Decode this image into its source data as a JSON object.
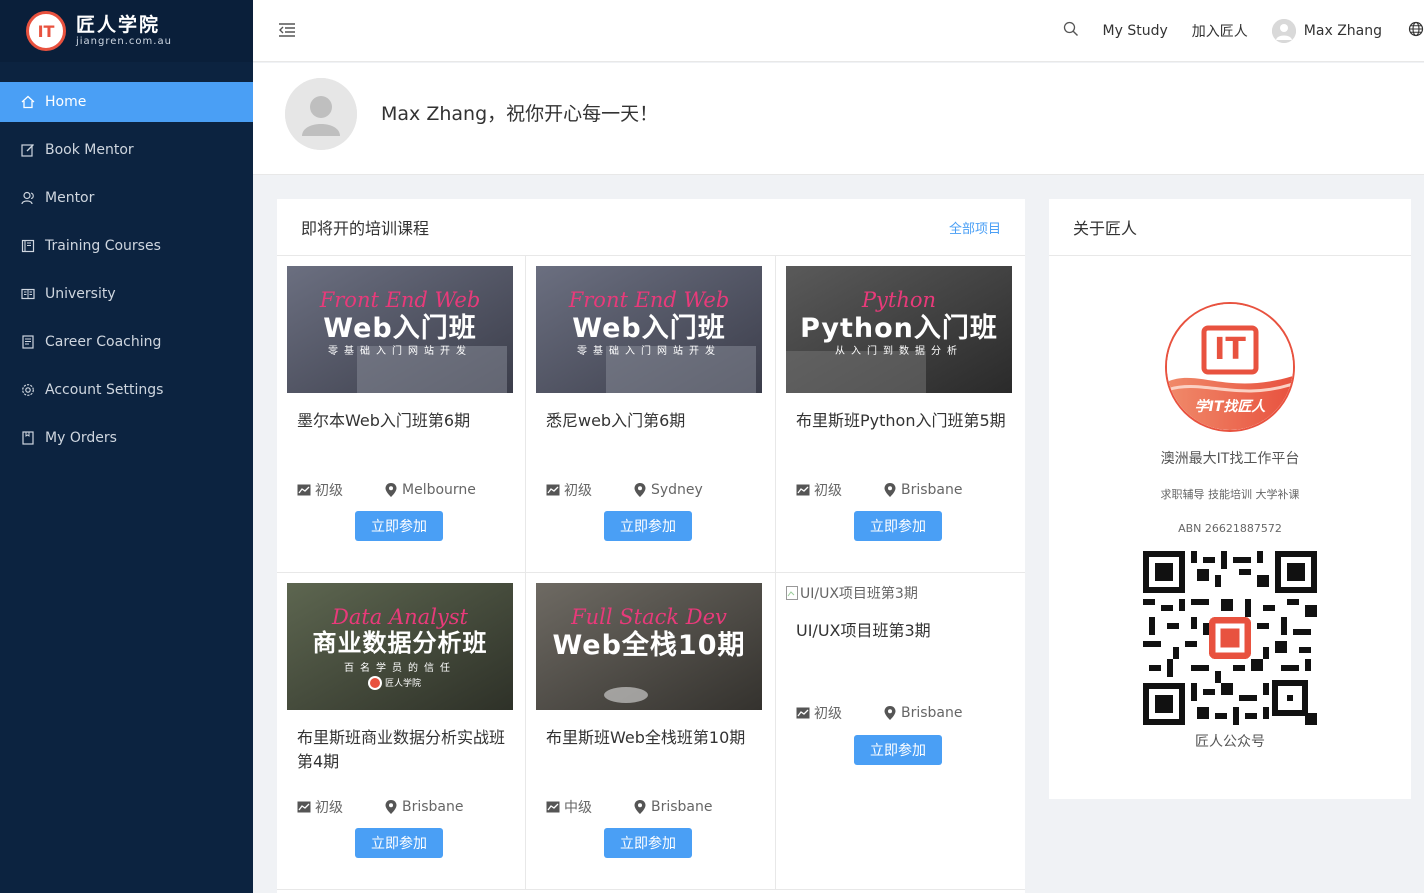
{
  "sidebar": {
    "logo": {
      "cn": "匠人学院",
      "en": "jiangren.com.au",
      "mark": "IT"
    },
    "items": [
      {
        "label": "Home",
        "icon": "home-icon",
        "active": true
      },
      {
        "label": "Book Mentor",
        "icon": "edit-icon"
      },
      {
        "label": "Mentor",
        "icon": "users-icon"
      },
      {
        "label": "Training Courses",
        "icon": "book-icon"
      },
      {
        "label": "University",
        "icon": "open-book-icon"
      },
      {
        "label": "Career Coaching",
        "icon": "document-icon"
      },
      {
        "label": "Account Settings",
        "icon": "gear-icon"
      },
      {
        "label": "My Orders",
        "icon": "clipboard-icon"
      }
    ],
    "colors": {
      "bg": "#0c2340",
      "active": "#4a9ff5"
    }
  },
  "header": {
    "my_study": "My Study",
    "join": "加入匠人",
    "user_name": "Max Zhang"
  },
  "welcome": {
    "text": "Max Zhang，祝你开心每一天！"
  },
  "courses": {
    "title": "即将开的培训课程",
    "all_link": "全部项目",
    "button_label": "立即参加",
    "items": [
      {
        "title": "墨尔本Web入门班第6期",
        "level": "初级",
        "location": "Melbourne",
        "thumb_script": "Front End Web",
        "thumb_main": "Web入门班",
        "thumb_sub": "零基础入门网站开发"
      },
      {
        "title": "悉尼web入门第6期",
        "level": "初级",
        "location": "Sydney",
        "thumb_script": "Front End Web",
        "thumb_main": "Web入门班",
        "thumb_sub": "零基础入门网站开发"
      },
      {
        "title": "布里斯班Python入门班第5期",
        "level": "初级",
        "location": "Brisbane",
        "thumb_script": "Python",
        "thumb_main": "Python入门班",
        "thumb_sub": "从入门到数据分析"
      },
      {
        "title": "布里斯班商业数据分析实战班第4期",
        "level": "初级",
        "location": "Brisbane",
        "thumb_script": "Data Analyst",
        "thumb_main": "商业数据分析班",
        "thumb_sub": "百名学员的信任",
        "thumb_brand": "匠人学院"
      },
      {
        "title": "布里斯班Web全栈班第10期",
        "level": "中级",
        "location": "Brisbane",
        "thumb_script": "Full Stack Dev",
        "thumb_main": "Web全栈10期",
        "thumb_sub": ""
      },
      {
        "title": "UI/UX项目班第3期",
        "level": "初级",
        "location": "Brisbane",
        "thumb_alt": "UI/UX项目班第3期"
      }
    ]
  },
  "about": {
    "title": "关于匠人",
    "logo_mark": "IT",
    "logo_slogan": "学IT找匠人",
    "desc": "澳洲最大IT找工作平台",
    "services": "求职辅导 技能培训 大学补课",
    "abn": "ABN 26621887572",
    "qr_caption": "匠人公众号"
  }
}
